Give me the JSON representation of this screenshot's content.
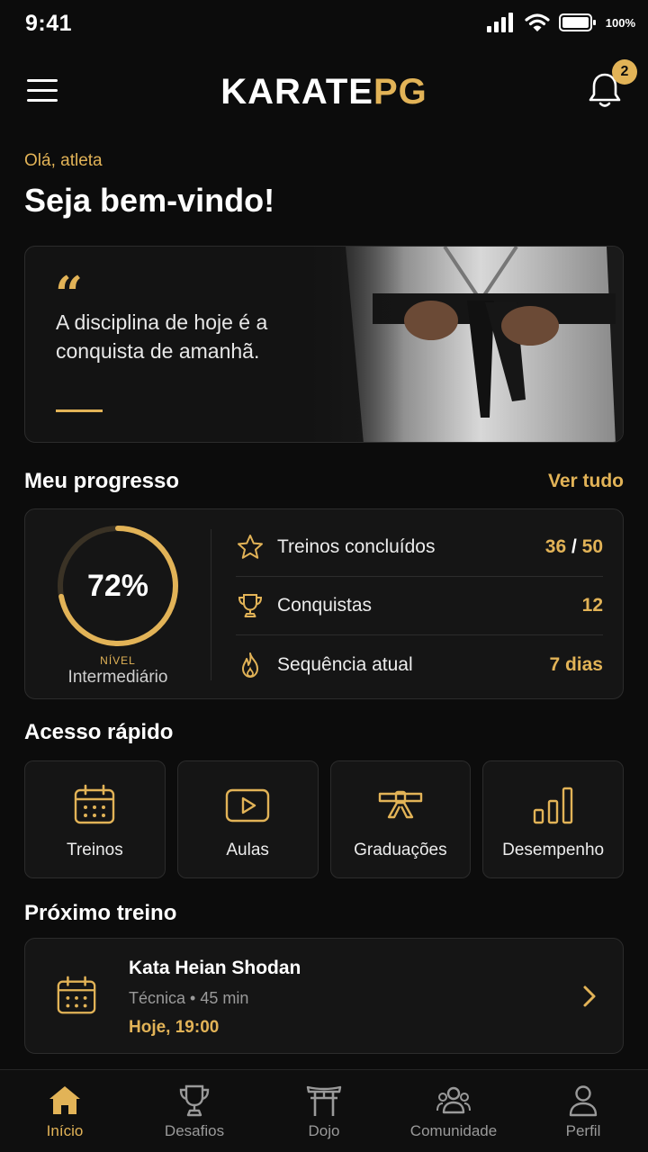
{
  "status_bar": {
    "time": "9:41",
    "battery": "100%"
  },
  "header": {
    "logo_white": "KARATE",
    "logo_gold": "PG",
    "notification_count": "2"
  },
  "greeting": {
    "small": "Olá, atleta",
    "title": "Seja bem-vindo!"
  },
  "quote": {
    "mark": "“",
    "text": "A disciplina de hoje é a conquista de amanhã."
  },
  "progress": {
    "title": "Meu progresso",
    "see_all": "Ver tudo",
    "percent_label": "72%",
    "percent": 72,
    "level_label": "NÍVEL",
    "level_value": "Intermediário",
    "stats": [
      {
        "label": "Treinos concluídos",
        "value_a": "36",
        "sep": " / ",
        "value_b": "50"
      },
      {
        "label": "Conquistas",
        "value": "12"
      },
      {
        "label": "Sequência atual",
        "value": "7 dias"
      }
    ]
  },
  "quick_access": {
    "title": "Acesso rápido",
    "items": [
      {
        "label": "Treinos",
        "icon": "calendar-icon"
      },
      {
        "label": "Aulas",
        "icon": "play-icon"
      },
      {
        "label": "Graduações",
        "icon": "belt-icon"
      },
      {
        "label": "Desempenho",
        "icon": "bar-chart-icon"
      }
    ]
  },
  "next_training": {
    "title": "Próximo treino",
    "name": "Kata Heian Shodan",
    "meta": "Técnica • 45 min",
    "time": "Hoje, 19:00"
  },
  "bottom_nav": {
    "items": [
      {
        "label": "Início",
        "icon": "home-icon",
        "active": true
      },
      {
        "label": "Desafios",
        "icon": "trophy-icon"
      },
      {
        "label": "Dojo",
        "icon": "torii-icon"
      },
      {
        "label": "Comunidade",
        "icon": "community-icon"
      },
      {
        "label": "Perfil",
        "icon": "profile-icon"
      }
    ]
  },
  "colors": {
    "accent": "#e2b357",
    "background": "#0c0c0c",
    "card": "#151515",
    "border": "#2c2c2c"
  }
}
